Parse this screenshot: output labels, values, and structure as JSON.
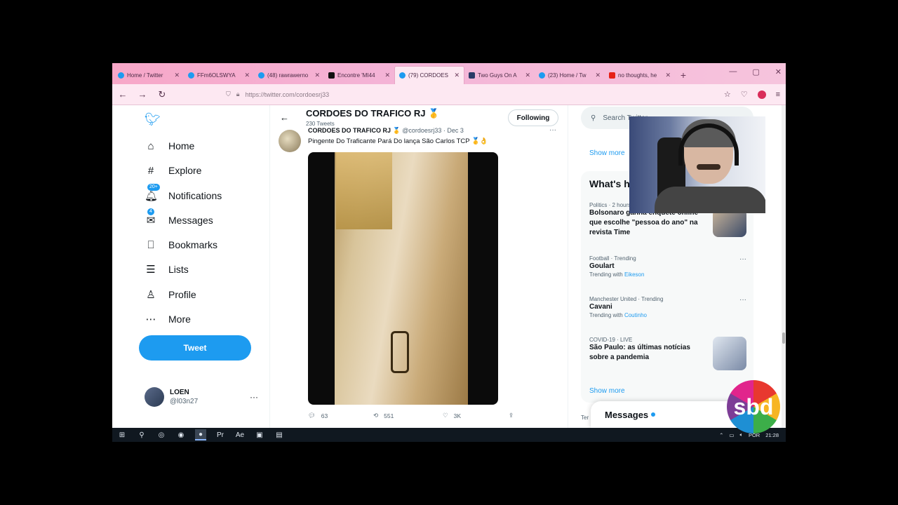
{
  "browser": {
    "tabs": [
      {
        "title": "Home / Twitter",
        "icon": "twitter-icon",
        "active": false
      },
      {
        "title": "FFm6OLSWYA",
        "icon": "twitter-icon",
        "active": false
      },
      {
        "title": "(48) rawrawerno",
        "icon": "twitter-icon",
        "active": false
      },
      {
        "title": "Encontre 'MI44",
        "icon": "tiktok-icon",
        "active": false
      },
      {
        "title": "(79) CORDOES",
        "icon": "twitter-icon",
        "active": true
      },
      {
        "title": "Two Guys On A",
        "icon": "book-icon",
        "active": false
      },
      {
        "title": "(23) Home / Tw",
        "icon": "twitter-icon",
        "active": false
      },
      {
        "title": "no thoughts, he",
        "icon": "youtube-icon",
        "active": false
      }
    ],
    "url": "https://twitter.com/cordoesrj33"
  },
  "twitter": {
    "nav": {
      "home": "Home",
      "explore": "Explore",
      "notifications": "Notifications",
      "notifications_badge": "20+",
      "messages": "Messages",
      "messages_badge": "4",
      "bookmarks": "Bookmarks",
      "lists": "Lists",
      "profile": "Profile",
      "more": "More",
      "tweet_button": "Tweet"
    },
    "account": {
      "name": "LOEN",
      "handle": "@l03n27"
    },
    "profile": {
      "name": "CORDOES DO TRAFICO RJ 🥇",
      "tweet_count": "230 Tweets",
      "follow_state": "Following"
    },
    "tweet": {
      "author": "CORDOES DO TRAFICO RJ 🥇",
      "handle_date": "@cordoesrj33 · Dec 3",
      "text": "Pingente Do Traficante Pará Do lança São Carlos TCP 🥇👌",
      "replies": "63",
      "retweets": "551",
      "likes": "3K"
    },
    "right": {
      "search_placeholder": "Search Twitter",
      "show_more": "Show more",
      "trends_title": "What's happening",
      "trends": [
        {
          "context": "Politics · 2 hours ago",
          "name": "Bolsonaro ganha enquete online que escolhe \"pessoa do ano\" na revista Time",
          "sub_prefix": "",
          "sub_link": ""
        },
        {
          "context": "Football · Trending",
          "name": "Goulart",
          "sub_prefix": "Trending with ",
          "sub_link": "Eikeson"
        },
        {
          "context": "Manchester United · Trending",
          "name": "Cavani",
          "sub_prefix": "Trending with ",
          "sub_link": "Coutinho"
        },
        {
          "context": "COVID-19 · LIVE",
          "name": "São Paulo: as últimas notícias sobre a pandemia",
          "sub_prefix": "",
          "sub_link": ""
        }
      ],
      "show_more_bottom": "Show more",
      "messages_drawer": "Messages",
      "footer_partial": "Ter"
    }
  },
  "taskbar": {
    "lang": "POR",
    "time": "21:28"
  },
  "overlay": {
    "logo_text": "sbd"
  },
  "colors": {
    "twitter_blue": "#1d9bf0",
    "tab_bar": "#f7a7c8"
  }
}
